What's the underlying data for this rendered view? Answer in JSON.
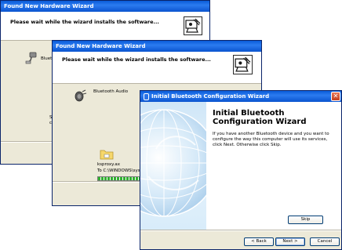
{
  "window_back": {
    "title": "Found New Hardware Wizard",
    "header_text": "Please wait while the wizard installs the software...",
    "device_label": "Bluetoo",
    "partial_text_line1": "Se",
    "partial_text_line2": "ca"
  },
  "window_middle": {
    "title": "Found New Hardware Wizard",
    "header_text": "Please wait while the wizard installs the software...",
    "device_label": "Bluetooth Audio",
    "file_name": "ksproxy.ax",
    "file_destination": "To C:\\WINDOWS\\sys",
    "progress_fraction": 1.0
  },
  "window_front": {
    "title": "Initial Bluetooth Configuration Wizard",
    "close_glyph": "✕",
    "heading": "Initial Bluetooth Configuration Wizard",
    "body": "If you have another Bluetooth device and you want to configure the way this computer will use its services, click Next. Otherwise click Skip.",
    "skip_label": "Skip",
    "back_label": "< Back",
    "next_label": "Next >",
    "cancel_label": "Cancel"
  },
  "colors": {
    "titlebar_blue": "#0a5bd8",
    "dialog_face": "#ece9d8",
    "progress_green": "#31b22f",
    "close_red": "#c53f1d"
  },
  "icons": {
    "wizard_emblem": "hardware-wizard-icon",
    "device": "bluetooth-device-icon",
    "audio": "bluetooth-audio-icon",
    "folder": "folder-copy-icon",
    "title_bluetooth": "bluetooth-icon"
  }
}
